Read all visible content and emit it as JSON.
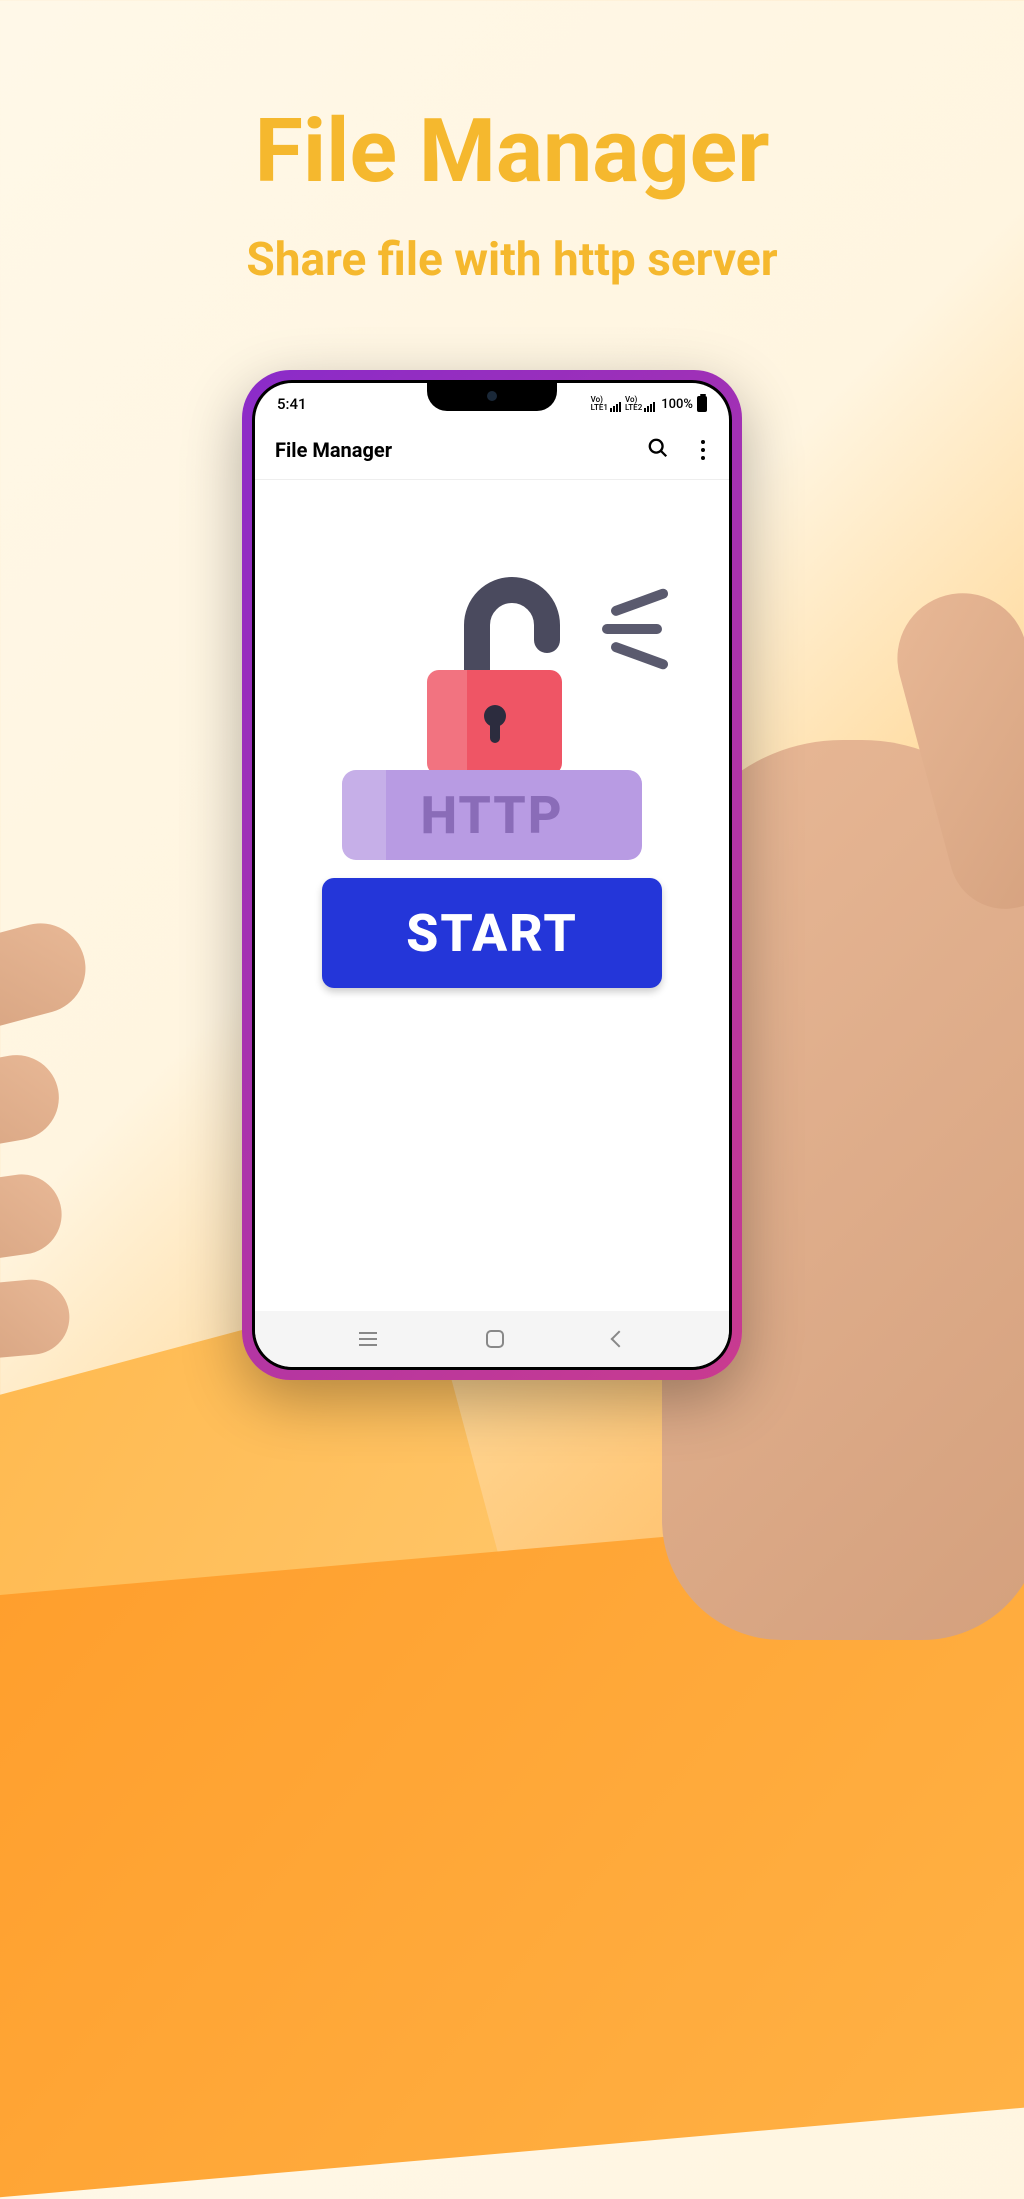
{
  "promo": {
    "title": "File Manager",
    "subtitle": "Share file with http server"
  },
  "statusBar": {
    "time": "5:41",
    "network1": "LTE1",
    "network2": "LTE2",
    "battery": "100%"
  },
  "appBar": {
    "title": "File Manager"
  },
  "content": {
    "httpLabel": "HTTP",
    "startLabel": "START"
  },
  "colors": {
    "accent": "#f5b82e",
    "primary": "#2436d9",
    "lockBody": "#ef5565",
    "httpBadge": "#b89be3"
  }
}
